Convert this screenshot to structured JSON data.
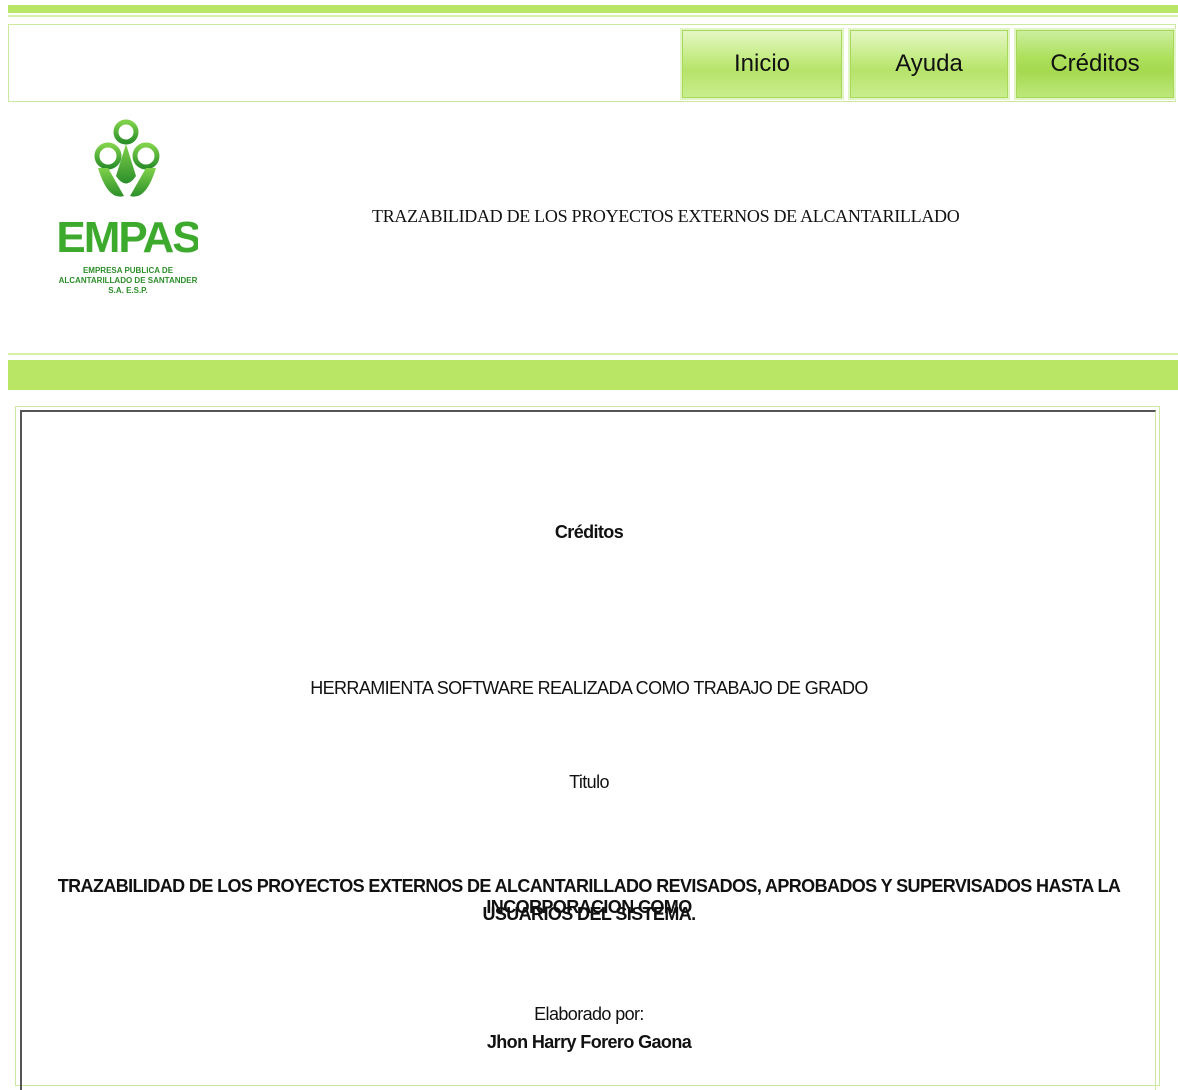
{
  "nav": {
    "items": [
      {
        "label": "Inicio"
      },
      {
        "label": "Ayuda"
      },
      {
        "label": "Créditos"
      }
    ]
  },
  "logo": {
    "name": "EMPAS",
    "subtitle_line1": "EMPRESA PUBLICA DE",
    "subtitle_line2": "ALCANTARILLADO DE SANTANDER",
    "subtitle_line3": "S.A. E.S.P."
  },
  "header": {
    "title": "TRAZABILIDAD DE LOS PROYECTOS EXTERNOS DE ALCANTARILLADO"
  },
  "content": {
    "heading": "Créditos",
    "line1": "HERRAMIENTA SOFTWARE REALIZADA COMO TRABAJO DE GRADO",
    "titulo_label": "Titulo",
    "project_title_line1": "TRAZABILIDAD DE LOS PROYECTOS EXTERNOS DE ALCANTARILLADO REVISADOS, APROBADOS Y SUPERVISADOS HASTA LA INCORPORACION COMO",
    "project_title_line2": "USUARIOS DEL SISTEMA.",
    "author_label": "Elaborado por:",
    "author_name": "Jhon Harry Forero Gaona"
  },
  "colors": {
    "accent_green": "#b9e664",
    "logo_green": "#3daa2e"
  }
}
